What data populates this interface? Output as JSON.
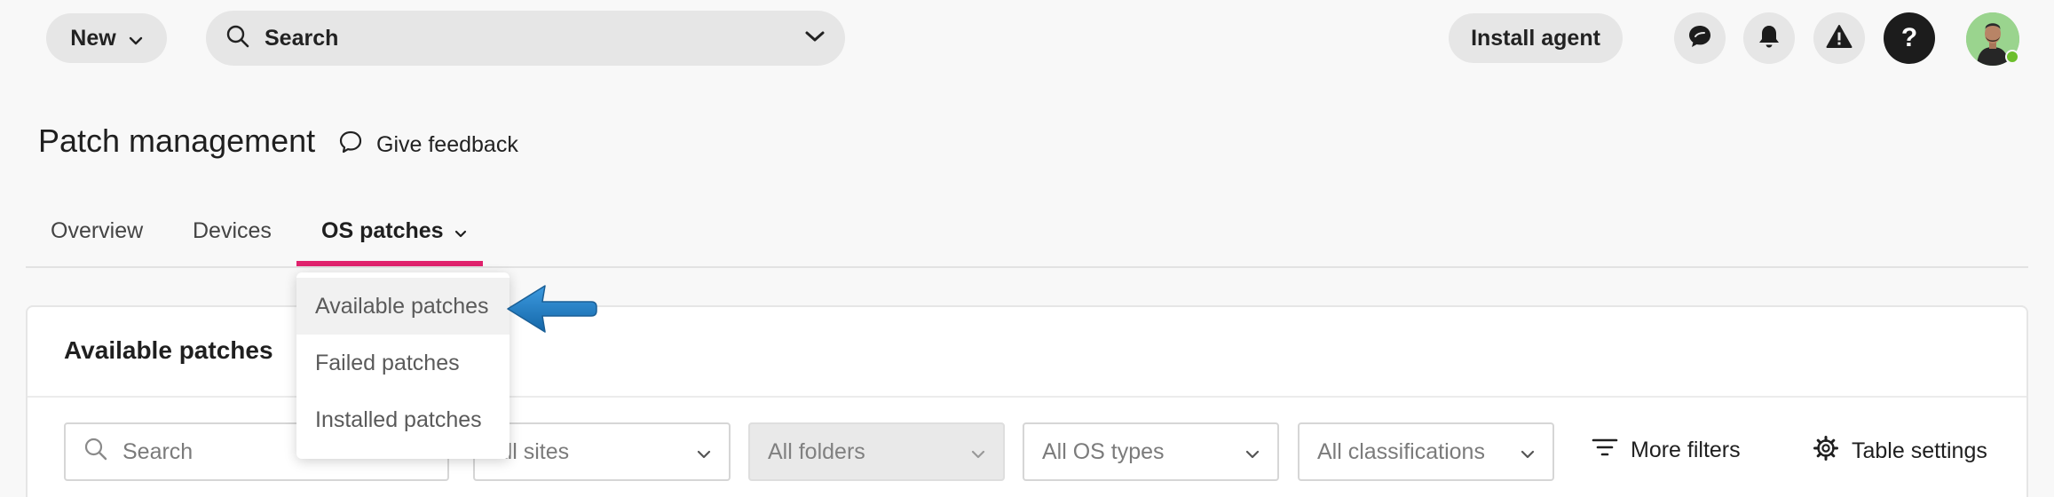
{
  "topbar": {
    "new_label": "New",
    "search_label": "Search",
    "install_label": "Install agent",
    "help_label": "?",
    "icons": [
      "chat-icon",
      "bell-icon",
      "warning-icon",
      "help-icon"
    ]
  },
  "page": {
    "title": "Patch management",
    "feedback_label": "Give feedback"
  },
  "tabs": {
    "overview": "Overview",
    "devices": "Devices",
    "os_patches": "OS patches"
  },
  "dropdown": {
    "items": [
      "Available patches",
      "Failed patches",
      "Installed patches"
    ],
    "hovered": "Available patches"
  },
  "panel": {
    "title": "Available patches",
    "search_placeholder": "Search",
    "filters": {
      "sites": "All sites",
      "folders": "All folders",
      "os_types": "All OS types",
      "classifications": "All classifications"
    },
    "more_filters": "More filters",
    "table_settings": "Table settings"
  },
  "colors": {
    "accent": "#e0226d",
    "help_button": "#1c1c1c",
    "status_online": "#6cbf2c",
    "annotation_arrow": "#1f7fc1"
  }
}
